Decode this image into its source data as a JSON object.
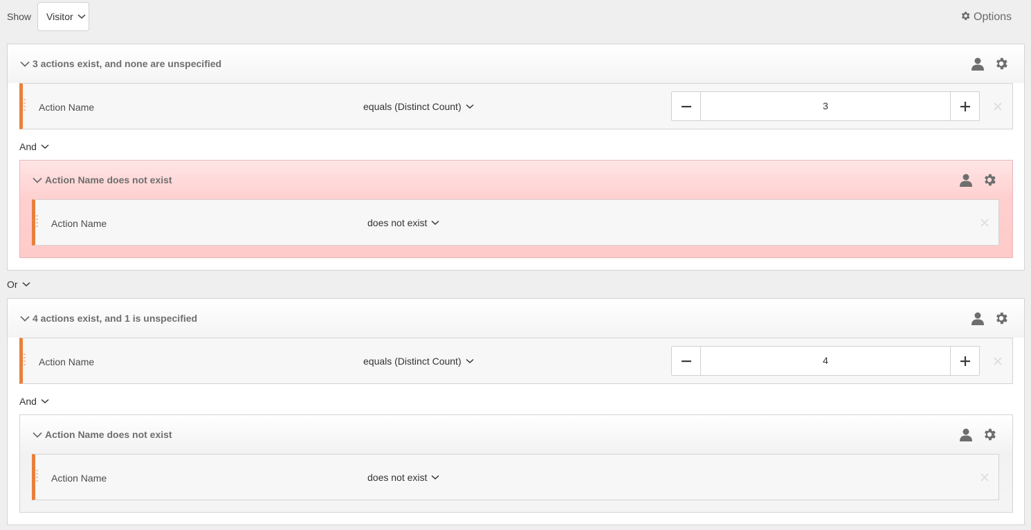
{
  "topbar": {
    "show_label": "Show",
    "show_value": "Visitor",
    "options_label": "Options"
  },
  "colors": {
    "accent_rule": "#e8803c",
    "error_background": "#ffcaca"
  },
  "groups": [
    {
      "title": "3 actions exist, and none are unspecified",
      "rule": {
        "label": "Action Name",
        "operator": "equals (Distinct Count)",
        "value": "3"
      },
      "conjunction": "And",
      "nested": {
        "title": "Action Name does not exist",
        "state": "error",
        "rule": {
          "label": "Action Name",
          "operator": "does not exist"
        }
      }
    },
    {
      "title": "4 actions exist, and 1 is unspecified",
      "rule": {
        "label": "Action Name",
        "operator": "equals (Distinct Count)",
        "value": "4"
      },
      "conjunction": "And",
      "nested": {
        "title": "Action Name does not exist",
        "state": "normal",
        "rule": {
          "label": "Action Name",
          "operator": "does not exist"
        }
      }
    }
  ],
  "between_groups": "Or",
  "icons": [
    "chevron-down-icon",
    "gear-icon",
    "person-icon",
    "minus-icon",
    "plus-icon",
    "close-icon",
    "drag-handle-icon"
  ]
}
